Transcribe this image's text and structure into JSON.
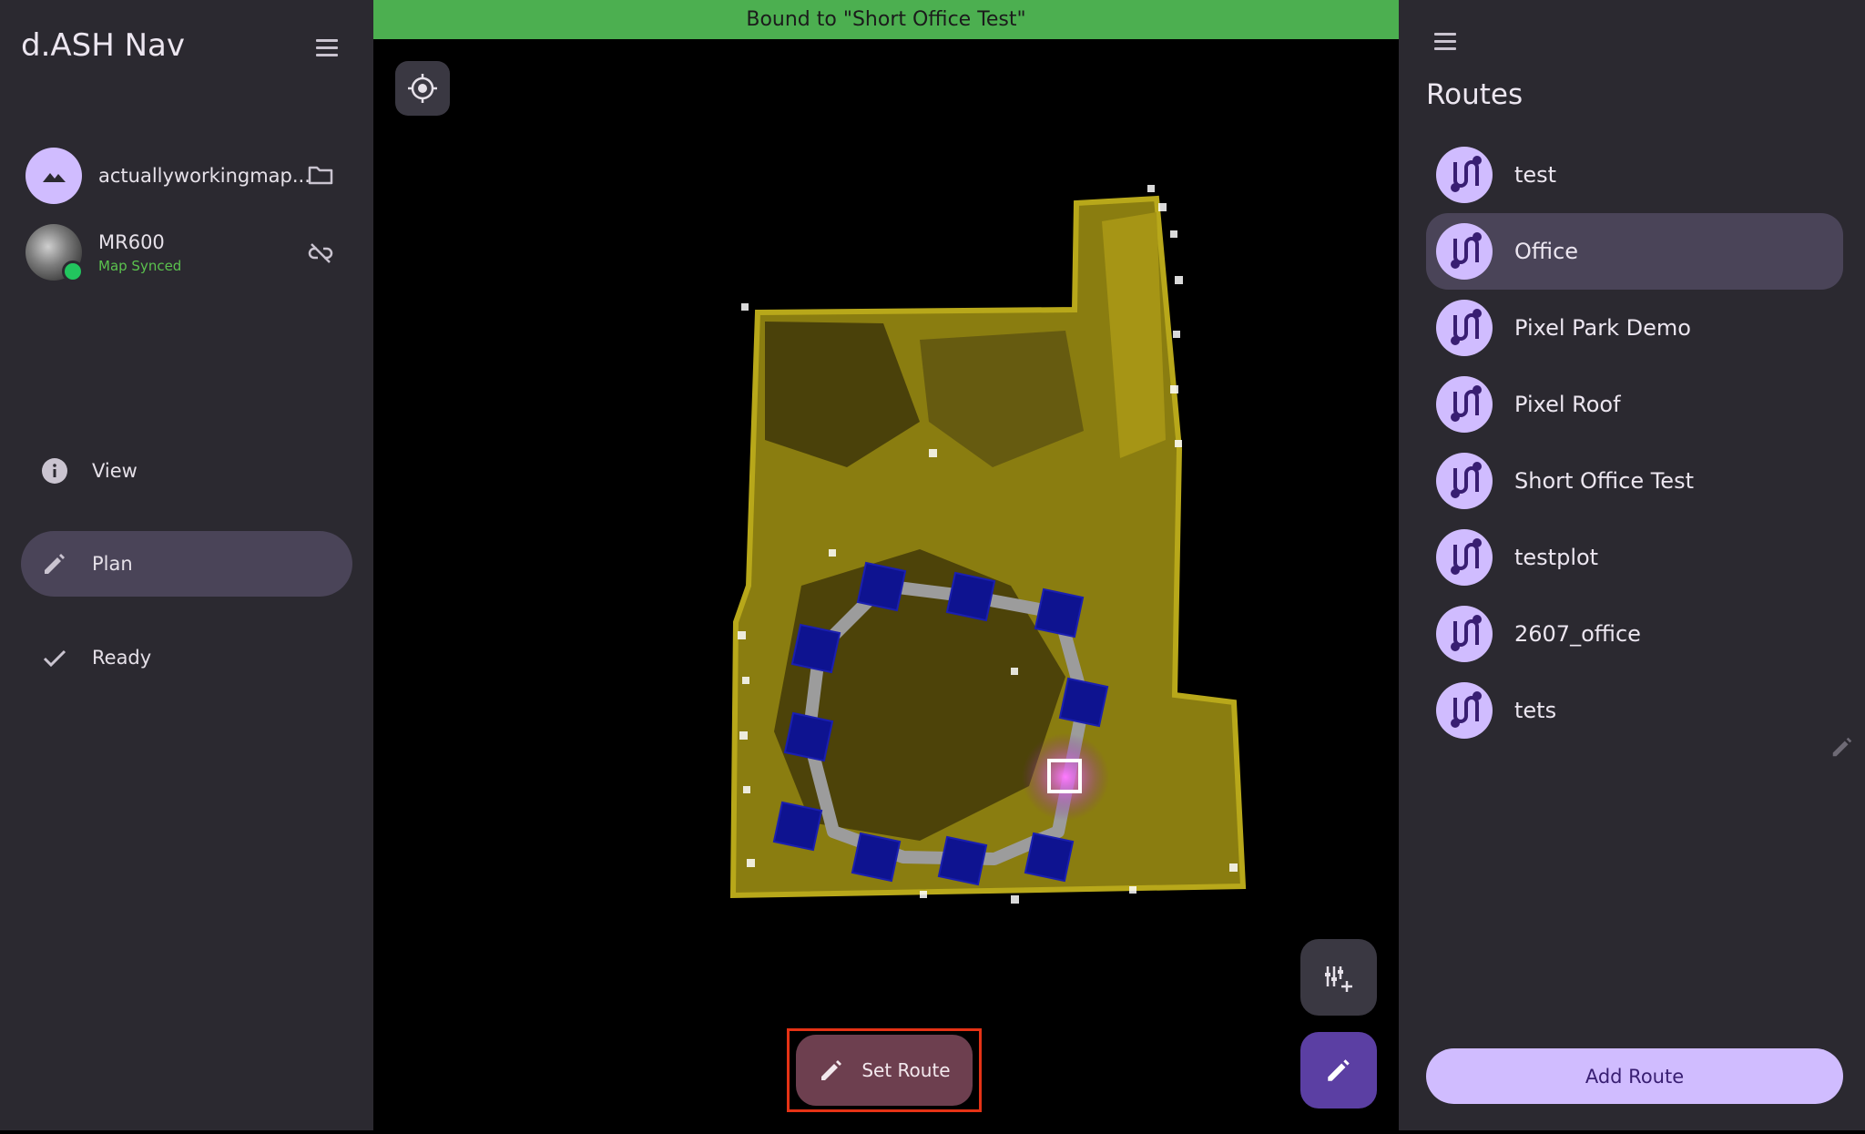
{
  "left_drawer": {
    "app_title": "d.ASH Nav",
    "menu_icon": "menu-icon",
    "map": {
      "name": "actuallyworkingmap...",
      "avatar_icon": "terrain-icon",
      "action_icon": "folder-icon"
    },
    "robot": {
      "name": "MR600",
      "status": "Map Synced",
      "status_color": "#5bc24e",
      "online_color": "#22c55e",
      "action_icon": "link-off-icon"
    },
    "nav": [
      {
        "label": "View",
        "icon": "info-icon",
        "selected": false
      },
      {
        "label": "Plan",
        "icon": "pencil-icon",
        "selected": true
      },
      {
        "label": "Ready",
        "icon": "check-icon",
        "selected": false
      }
    ]
  },
  "map_view": {
    "banner": "Bound to \"Short Office Test\"",
    "banner_color": "#4caf50",
    "locate_icon": "my-location-icon",
    "set_route_label": "Set Route",
    "set_route_icon": "pencil-icon",
    "fab_add_icon": "add-waypoint-icon",
    "fab_edit_icon": "pencil-icon"
  },
  "routes_panel": {
    "title": "Routes",
    "menu_icon": "menu-icon",
    "items": [
      {
        "label": "test",
        "selected": false
      },
      {
        "label": "Office",
        "selected": true
      },
      {
        "label": "Pixel Park Demo",
        "selected": false
      },
      {
        "label": "Pixel Roof",
        "selected": false
      },
      {
        "label": "Short Office Test",
        "selected": false
      },
      {
        "label": "testplot",
        "selected": false
      },
      {
        "label": "2607_office",
        "selected": false
      },
      {
        "label": "tets",
        "selected": false
      }
    ],
    "add_route_label": "Add Route",
    "accent_color": "#d0bcff"
  }
}
